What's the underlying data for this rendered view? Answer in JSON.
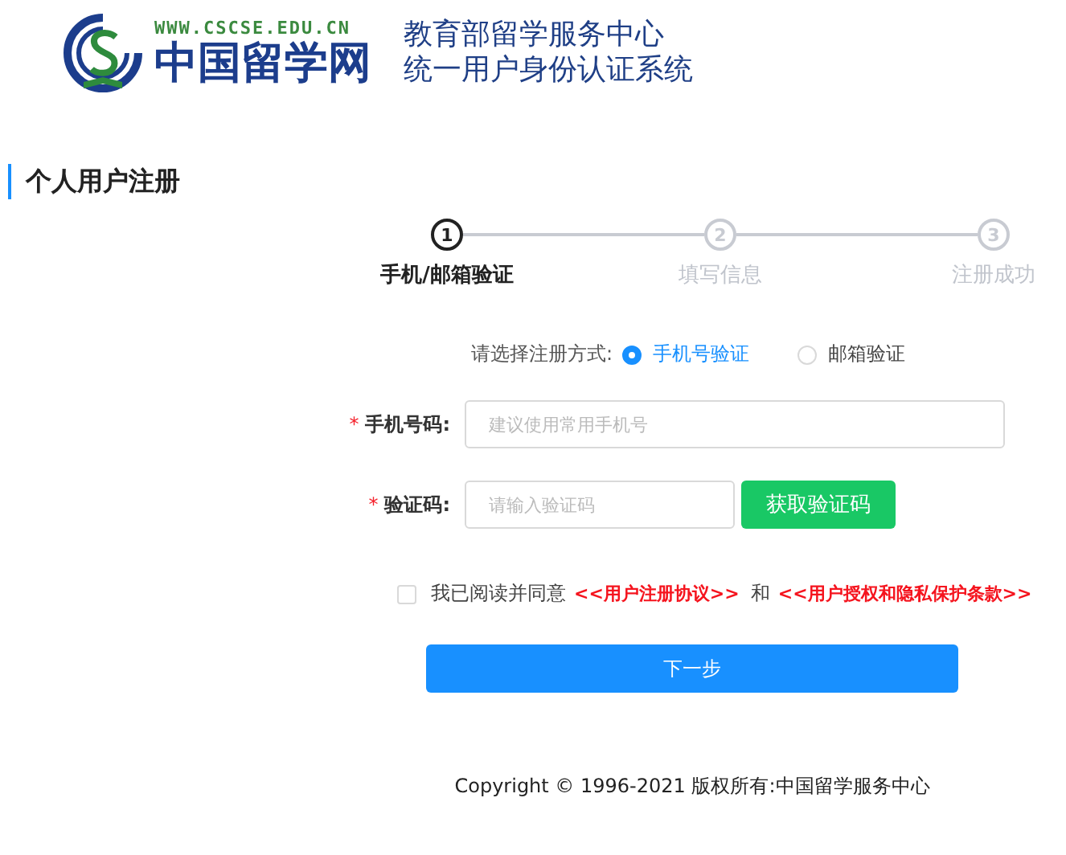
{
  "header": {
    "site_url": "WWW.CSCSE.EDU.CN",
    "site_name": "中国留学网",
    "title_lines": [
      "教育部留学服务中心",
      "统一用户身份认证系统"
    ]
  },
  "page_title": "个人用户注册",
  "steps": [
    {
      "number": "1",
      "label": "手机/邮箱验证",
      "selected": true
    },
    {
      "number": "2",
      "label": "填写信息",
      "selected": false
    },
    {
      "number": "3",
      "label": "注册成功",
      "selected": false
    }
  ],
  "method": {
    "label": "请选择注册方式:",
    "options": [
      {
        "label": "手机号验证",
        "selected": true
      },
      {
        "label": "邮箱验证",
        "selected": false
      }
    ]
  },
  "fields": [
    {
      "required_mark": "*",
      "label": "手机号码:",
      "placeholder": "建议使用常用手机号",
      "kind": "text"
    },
    {
      "required_mark": "*",
      "label": "验证码:",
      "placeholder": "请输入验证码",
      "kind": "code",
      "button": "获取验证码"
    }
  ],
  "agreement": {
    "checked": false,
    "text": "我已阅读并同意",
    "link_1": "<<用户注册协议>>",
    "joiner": "和",
    "link_2": "<<用户授权和隐私保护条款>>"
  },
  "submit": "下一步",
  "footer": "Copyright © 1996-2021 版权所有:中国留学服务中心"
}
